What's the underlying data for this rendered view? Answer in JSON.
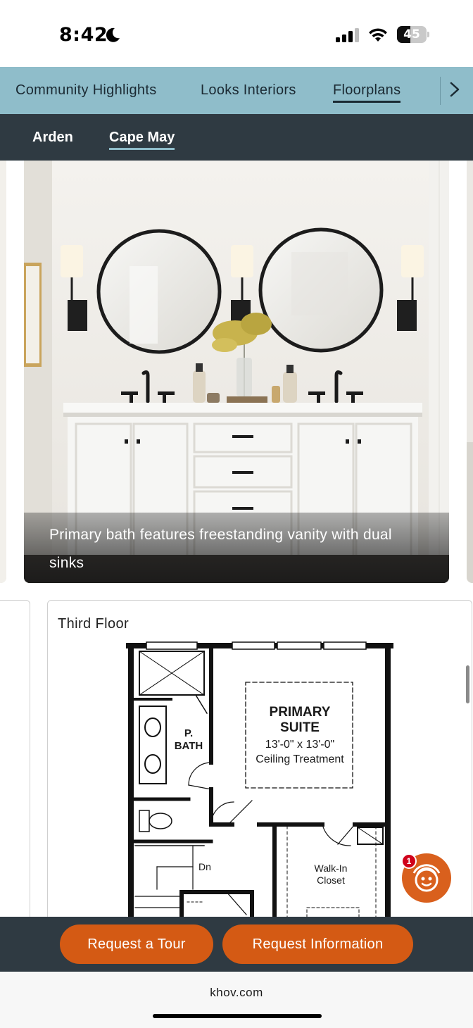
{
  "status_bar": {
    "time": "8:42",
    "battery_level": "45",
    "battery_fraction": 0.45,
    "icons": [
      "moon-icon",
      "cellular-signal-icon",
      "wifi-icon",
      "battery-icon"
    ]
  },
  "primary_nav": {
    "tabs": [
      {
        "label": "Community Highlights",
        "active": false
      },
      {
        "label": "Looks Interiors",
        "active": false
      },
      {
        "label": "Floorplans",
        "active": true
      }
    ],
    "next_icon": "chevron-right-icon"
  },
  "secondary_nav": {
    "tabs": [
      {
        "label": "Arden",
        "active": false
      },
      {
        "label": "Cape May",
        "active": true
      }
    ]
  },
  "gallery": {
    "caption": "Primary bath features freestanding vanity with dual sinks"
  },
  "floorplan": {
    "title": "Third Floor",
    "labels": {
      "primary_suite_name": "PRIMARY",
      "primary_suite_name2": "SUITE",
      "primary_suite_size": "13'-0\" x 13'-0\"",
      "primary_suite_note": "Ceiling Treatment",
      "bath_line1": "P.",
      "bath_line2": "BATH",
      "stairs": "Dn",
      "closet_line1": "Walk-In",
      "closet_line2": "Closet"
    }
  },
  "chat": {
    "badge_count": "1",
    "icon": "chatbot-icon"
  },
  "actions": {
    "tour_label": "Request a Tour",
    "info_label": "Request Information"
  },
  "browser": {
    "url": "khov.com"
  },
  "colors": {
    "nav_bg": "#8fbdca",
    "sub_nav_bg": "#2f3a42",
    "accent_orange": "#d45a14"
  }
}
